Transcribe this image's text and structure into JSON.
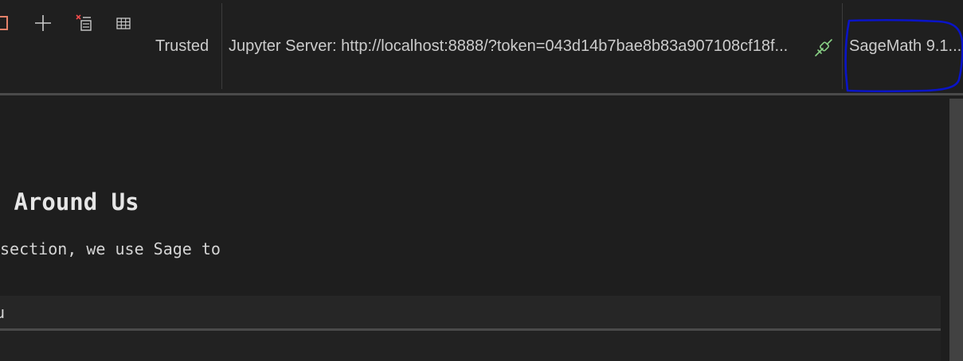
{
  "toolbar": {
    "icons": [
      {
        "name": "stop-icon",
        "color": "#e5826a"
      },
      {
        "name": "add-cell-icon",
        "color": "#cccccc"
      },
      {
        "name": "clear-outputs-icon",
        "color": "#cccccc",
        "accent": "#f14c4c"
      },
      {
        "name": "variables-grid-icon",
        "color": "#cccccc"
      }
    ],
    "trusted_label": "Trusted",
    "server_label": "Jupyter Server: http://localhost:8888/?token=043d14b7bae8b83a907108cf18f...",
    "server_icon": "plug-connected-icon",
    "kernel_label": "SageMath 9.1...",
    "annotation_color": "#0a14c8"
  },
  "notebook": {
    "heading": " Around Us",
    "paragraph": "section, we use Sage to",
    "code_cell_text": "u"
  },
  "colors": {
    "background": "#1e1e1e",
    "text": "#cccccc",
    "plug_icon": "#89d185"
  }
}
